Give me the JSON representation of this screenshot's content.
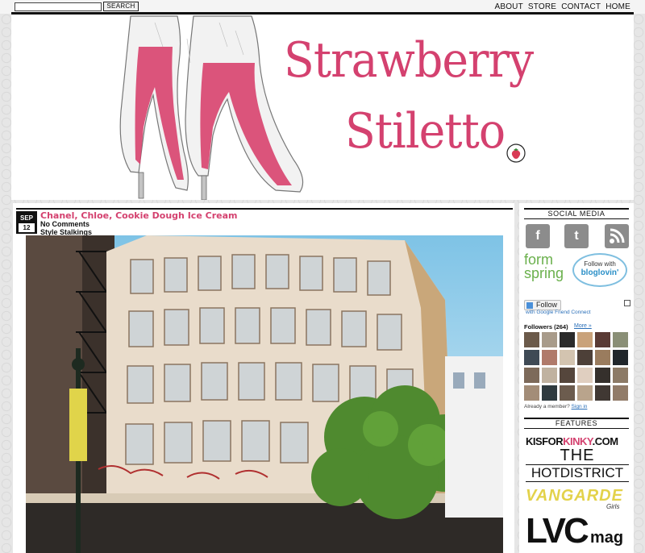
{
  "topbar": {
    "search_placeholder": "",
    "search_button": "SEARCH",
    "nav": [
      "ABOUT",
      "STORE",
      "CONTACT",
      "HOME"
    ]
  },
  "header": {
    "logo_line1": "Strawberry",
    "logo_line2": "Stiletto",
    "brand_color": "#d4416f"
  },
  "post": {
    "date_month": "SEP",
    "date_day": "12",
    "title": "Chanel, Chloe, Cookie Dough Ice Cream",
    "comments": "No Comments",
    "category": "Style Stalkings"
  },
  "sidebar": {
    "social_heading": "SOCIAL MEDIA",
    "social_icons": [
      "facebook-icon",
      "twitter-icon",
      "rss-icon"
    ],
    "formspring_line1": "form",
    "formspring_line2": "spring",
    "bloglovin_line1": "Follow with",
    "bloglovin_line2": "bloglovin'",
    "follow_button": "Follow",
    "follow_sub": "with Google Friend Connect",
    "followers_label": "Followers (264)",
    "more_link": "More »",
    "member_text": "Already a member?",
    "sign_in": "Sign in",
    "features_heading": "FEATURES",
    "feature_kis_part1": "KISFOR",
    "feature_kis_part2": "KINKY",
    "feature_kis_part3": ".COM",
    "feature_the": "THE",
    "feature_hotdistrict": "HOTDISTRICT",
    "feature_vangarde": "VANGARDE",
    "feature_girls": "Girls",
    "feature_lvc": "LVC",
    "feature_mag": "mag"
  }
}
